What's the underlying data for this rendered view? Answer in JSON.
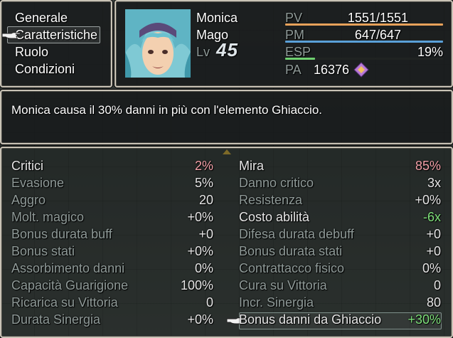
{
  "menu": {
    "items": [
      "Generale",
      "Caratteristiche",
      "Ruolo",
      "Condizioni"
    ],
    "selected_index": 1
  },
  "actor": {
    "name": "Monica",
    "class": "Mago",
    "level_label": "Lv",
    "level": "45",
    "hp_label": "PV",
    "hp": "1551/1551",
    "hp_fraction": 1.0,
    "mp_label": "PM",
    "mp": "647/647",
    "mp_fraction": 1.0,
    "exp_label": "ESP",
    "exp": "19%",
    "exp_fraction": 0.19,
    "ap_label": "PA",
    "ap": "16376"
  },
  "help": {
    "text": "Monica causa il 30% danni in più con l'elemento Ghiaccio."
  },
  "stats_left": [
    {
      "label": "Critici",
      "value": "2%",
      "value_color": "#f2a0a8",
      "active": true
    },
    {
      "label": "Evasione",
      "value": "5%",
      "value_color": "#e6e6e6",
      "active": false
    },
    {
      "label": "Aggro",
      "value": "20",
      "value_color": "#e6e6e6",
      "active": false
    },
    {
      "label": "Molt. magico",
      "value": "+0%",
      "value_color": "#e6e6e6",
      "active": false
    },
    {
      "label": "Bonus durata buff",
      "value": "+0",
      "value_color": "#e6e6e6",
      "active": false
    },
    {
      "label": "Bonus stati",
      "value": "+0%",
      "value_color": "#e6e6e6",
      "active": false
    },
    {
      "label": "Assorbimento danni",
      "value": "0%",
      "value_color": "#e6e6e6",
      "active": false
    },
    {
      "label": "Capacità Guarigione",
      "value": "100%",
      "value_color": "#e6e6e6",
      "active": false
    },
    {
      "label": "Ricarica su Vittoria",
      "value": "0",
      "value_color": "#e6e6e6",
      "active": false
    },
    {
      "label": "Durata Sinergia",
      "value": "+0%",
      "value_color": "#e6e6e6",
      "active": false
    }
  ],
  "stats_right": [
    {
      "label": "Mira",
      "value": "85%",
      "value_color": "#f2a0a8",
      "active": true
    },
    {
      "label": "Danno critico",
      "value": "3x",
      "value_color": "#e6e6e6",
      "active": false
    },
    {
      "label": "Resistenza",
      "value": "+0%",
      "value_color": "#e6e6e6",
      "active": false
    },
    {
      "label": "Costo abilità",
      "value": "-6x",
      "value_color": "#7ee07a",
      "active": true
    },
    {
      "label": "Difesa durata debuff",
      "value": "+0",
      "value_color": "#e6e6e6",
      "active": false
    },
    {
      "label": "Bonus durata stati",
      "value": "+0",
      "value_color": "#e6e6e6",
      "active": false
    },
    {
      "label": "Contrattacco fisico",
      "value": "0%",
      "value_color": "#e6e6e6",
      "active": false
    },
    {
      "label": "Cura su Vittoria",
      "value": "0",
      "value_color": "#e6e6e6",
      "active": false
    },
    {
      "label": "Incr. Sinergia",
      "value": "80",
      "value_color": "#e6e6e6",
      "active": false
    },
    {
      "label": "Bonus danni da Ghiaccio",
      "value": "+30%",
      "value_color": "#7ee07a",
      "active": true
    }
  ],
  "colors": {
    "hp_bar": "#e8a25a",
    "mp_bar": "#5aa0d8",
    "exp_bar": "#6fd070",
    "stat_label_dim": "#8f9a98"
  },
  "icons": [
    "pointing-hand-icon",
    "ap-gem-icon",
    "scroll-up-arrow-icon"
  ]
}
